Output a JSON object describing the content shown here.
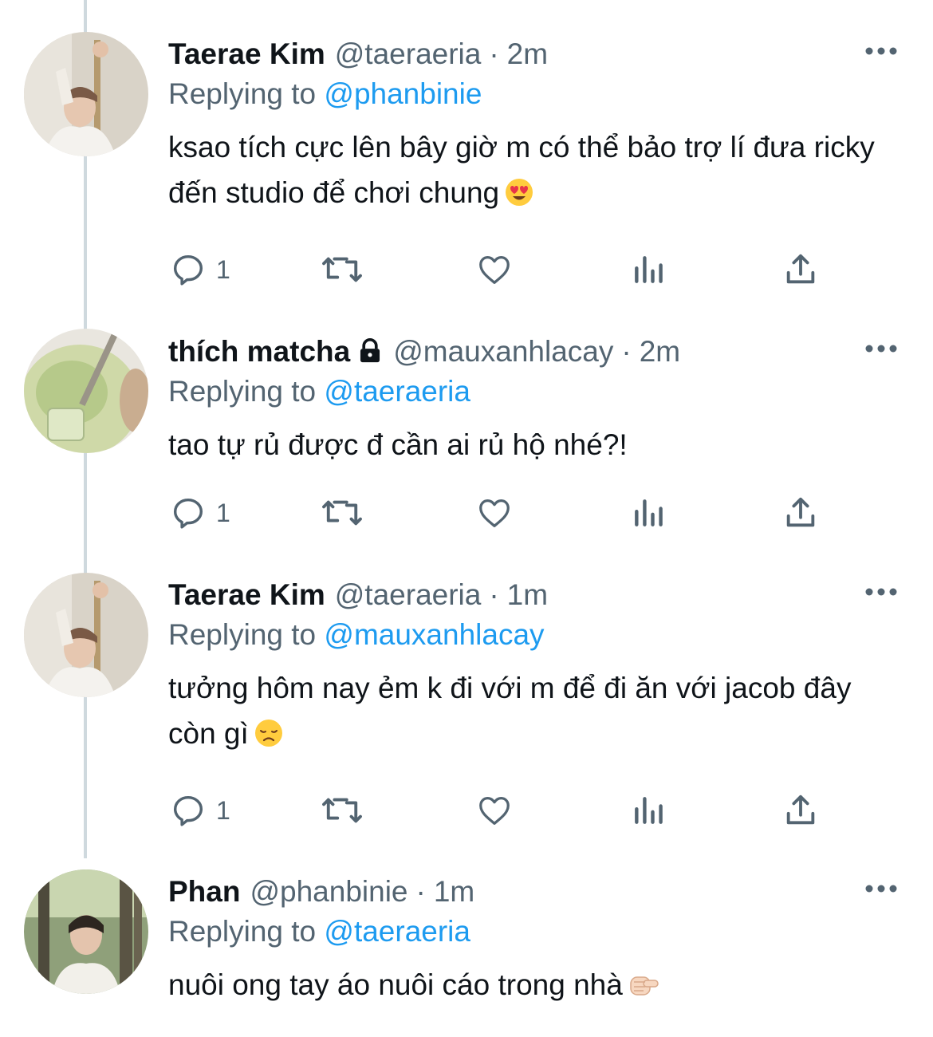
{
  "tweets": [
    {
      "name": "Taerae Kim",
      "handle": "@taeraeria",
      "separator": "·",
      "time": "2m",
      "replying_prefix": "Replying to",
      "replying_to": "@phanbinie",
      "text": "ksao tích cực lên bây giờ m có thể bảo trợ lí đưa ricky đến studio để chơi chung",
      "emoji": "smiling-face-with-heart-eyes",
      "reply_count": "1",
      "avatar": "photo-person-selfie",
      "locked": false
    },
    {
      "name": "thích matcha",
      "handle": "@mauxanhlacay",
      "separator": "·",
      "time": "2m",
      "replying_prefix": "Replying to",
      "replying_to": "@taeraeria",
      "text": "tao tự rủ được đ cần ai rủ hộ nhé?!",
      "emoji": "",
      "reply_count": "1",
      "avatar": "photo-matcha-drink",
      "locked": true
    },
    {
      "name": "Taerae Kim",
      "handle": "@taeraeria",
      "separator": "·",
      "time": "1m",
      "replying_prefix": "Replying to",
      "replying_to": "@mauxanhlacay",
      "text": "tưởng hôm nay ẻm k đi với m để đi ăn với jacob đây còn gì",
      "emoji": "disappointed-face",
      "reply_count": "1",
      "avatar": "photo-person-selfie",
      "locked": false
    },
    {
      "name": "Phan",
      "handle": "@phanbinie",
      "separator": "·",
      "time": "1m",
      "replying_prefix": "Replying to",
      "replying_to": "@taeraeria",
      "text": "nuôi ong tay áo nuôi cáo trong nhà",
      "emoji": "backhand-index-pointing-right",
      "reply_count": "",
      "avatar": "photo-person-forest",
      "locked": false
    }
  ],
  "icons": {
    "more": "more-horizontal-icon",
    "reply": "reply-icon",
    "retweet": "retweet-icon",
    "like": "heart-icon",
    "views": "analytics-icon",
    "share": "share-icon",
    "lock": "lock-icon"
  },
  "colors": {
    "text": "#0f1419",
    "secondary": "#536471",
    "link": "#1d9bf0",
    "thread_line": "#cfd9de"
  }
}
